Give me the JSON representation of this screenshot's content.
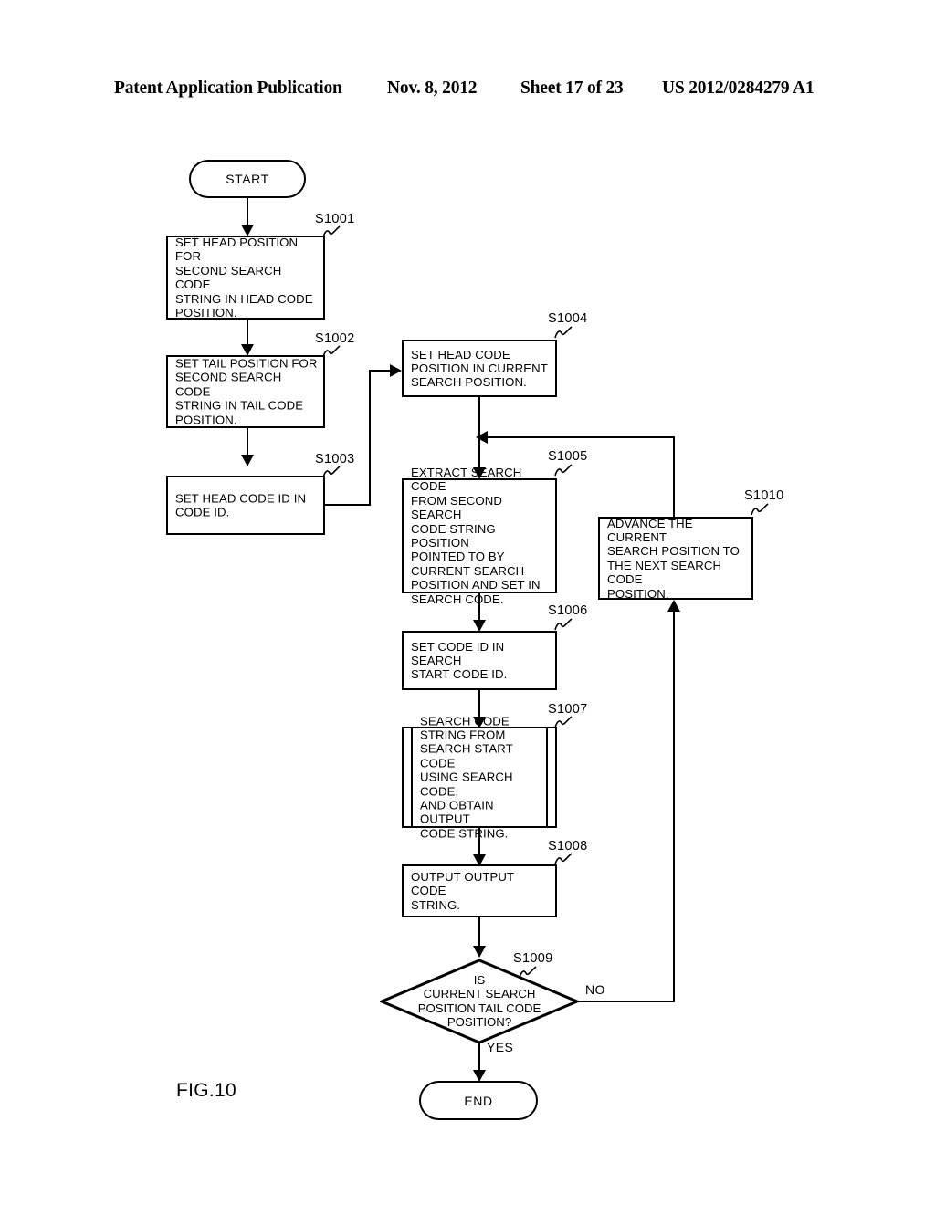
{
  "header": {
    "title": "Patent Application Publication",
    "date": "Nov. 8, 2012",
    "sheet": "Sheet 17 of 23",
    "publication_number": "US 2012/0284279 A1"
  },
  "figure": {
    "caption": "FIG.10"
  },
  "flowchart": {
    "start_label": "START",
    "end_label": "END",
    "branch_yes": "YES",
    "branch_no": "NO",
    "steps": [
      {
        "id": "S1001",
        "text": "SET HEAD POSITION FOR\nSECOND SEARCH CODE\nSTRING IN HEAD CODE\nPOSITION."
      },
      {
        "id": "S1002",
        "text": "SET TAIL POSITION FOR\nSECOND SEARCH CODE\nSTRING IN TAIL CODE\nPOSITION."
      },
      {
        "id": "S1003",
        "text": "SET HEAD CODE ID IN\nCODE ID."
      },
      {
        "id": "S1004",
        "text": "SET HEAD CODE\nPOSITION IN CURRENT\nSEARCH POSITION."
      },
      {
        "id": "S1005",
        "text": "EXTRACT SEARCH CODE\nFROM SECOND SEARCH\nCODE STRING POSITION\nPOINTED TO BY\nCURRENT SEARCH\nPOSITION AND SET IN\nSEARCH CODE."
      },
      {
        "id": "S1006",
        "text": "SET CODE ID IN SEARCH\nSTART CODE ID."
      },
      {
        "id": "S1007",
        "text": "SEARCH CODE\nSTRING FROM\nSEARCH START CODE\nUSING SEARCH CODE,\nAND OBTAIN OUTPUT\nCODE STRING."
      },
      {
        "id": "S1008",
        "text": "OUTPUT OUTPUT CODE\nSTRING."
      },
      {
        "id": "S1009",
        "text": "IS\nCURRENT SEARCH\nPOSITION TAIL CODE\nPOSITION?"
      },
      {
        "id": "S1010",
        "text": "ADVANCE THE CURRENT\nSEARCH POSITION TO\nTHE NEXT SEARCH CODE\nPOSITION."
      }
    ]
  }
}
